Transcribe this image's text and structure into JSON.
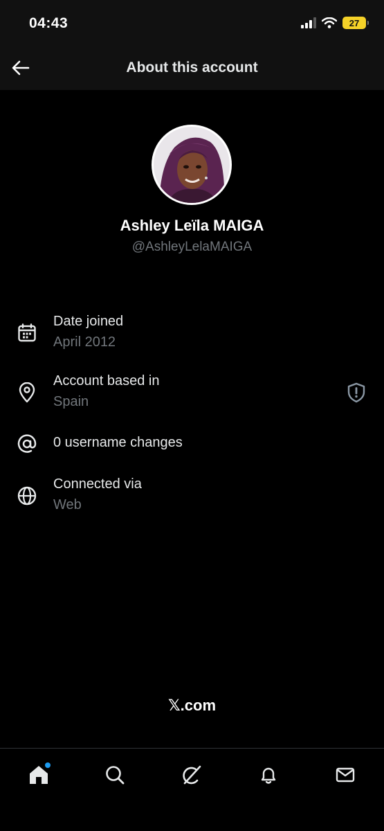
{
  "status_bar": {
    "time": "04:43",
    "battery": "27",
    "battery_color": "#f5d228"
  },
  "header": {
    "title": "About this account",
    "back_icon": "arrow-left-icon"
  },
  "profile": {
    "display_name": "Ashley Leïla MAIGA",
    "handle": "@AshleyLelaMAIGA"
  },
  "details": {
    "date_joined": {
      "label": "Date joined",
      "value": "April 2012",
      "icon": "calendar-icon"
    },
    "based_in": {
      "label": "Account based in",
      "value": "Spain",
      "icon": "location-pin-icon",
      "badge_icon": "shield-alert-icon"
    },
    "username_changes": {
      "label": "0 username changes",
      "icon": "at-sign-icon"
    },
    "connected_via": {
      "label": "Connected via",
      "value": "Web",
      "icon": "globe-icon"
    }
  },
  "footer": {
    "brand": "𝕏.com"
  },
  "bottom_nav": {
    "items": [
      "home-icon",
      "search-icon",
      "grok-icon",
      "bell-icon",
      "mail-icon"
    ],
    "active": "home",
    "notification_dot_color": "#1d9bf0"
  }
}
